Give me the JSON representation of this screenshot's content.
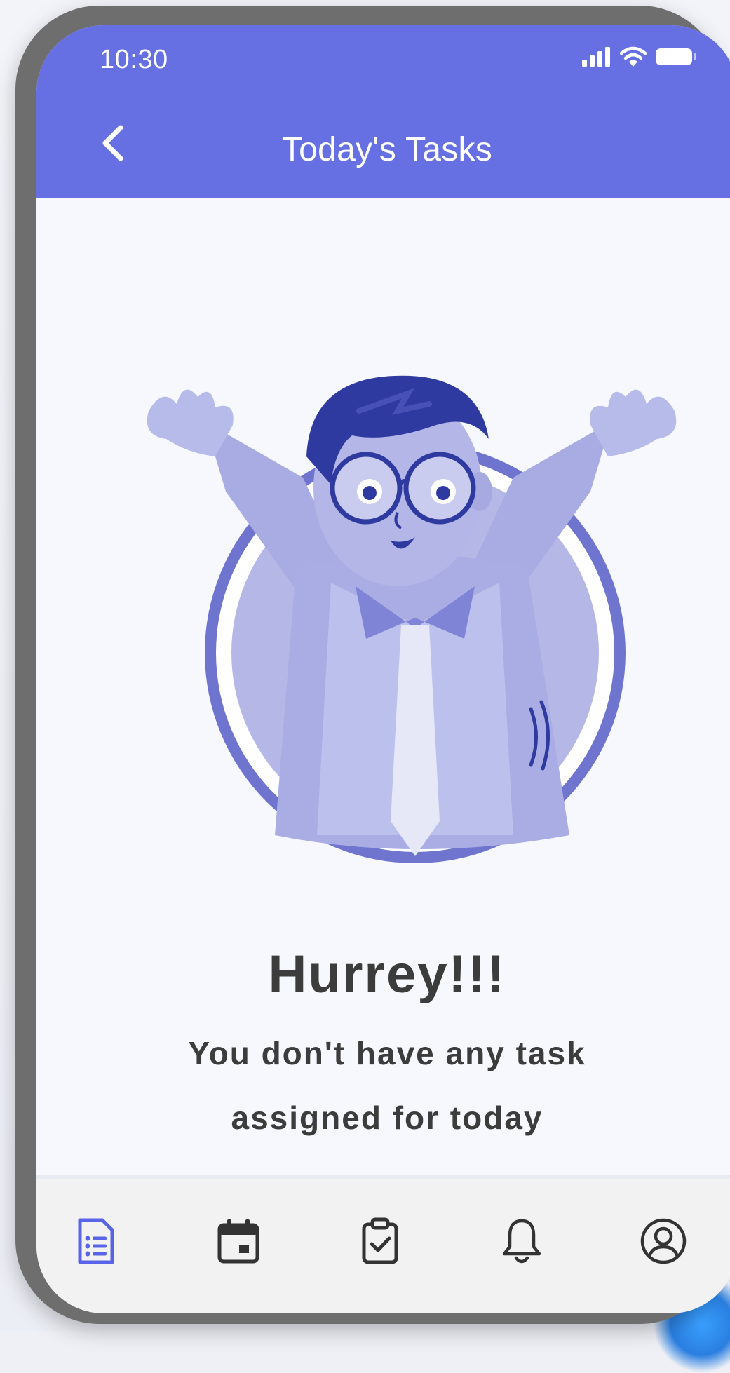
{
  "status_bar": {
    "time": "10:30",
    "icons": [
      "signal-icon",
      "wifi-icon",
      "battery-icon"
    ]
  },
  "header": {
    "title": "Today's Tasks",
    "back_icon": "chevron-left-icon"
  },
  "empty_state": {
    "illustration": "cheering-person-illustration",
    "heading": "Hurrey!!!",
    "message_line1": "You don't have any task",
    "message_line2": "assigned for today"
  },
  "bottom_nav": {
    "items": [
      {
        "icon": "task-list-icon",
        "active": true
      },
      {
        "icon": "calendar-icon",
        "active": false
      },
      {
        "icon": "clipboard-check-icon",
        "active": false
      },
      {
        "icon": "bell-icon",
        "active": false
      },
      {
        "icon": "profile-icon",
        "active": false
      }
    ]
  },
  "colors": {
    "primary": "#6670e2",
    "active_icon": "#5964e8",
    "inactive_icon": "#333333",
    "text": "#3c3c3c",
    "illustration_light": "#b3b6e6",
    "illustration_dark": "#2f3aa0"
  }
}
